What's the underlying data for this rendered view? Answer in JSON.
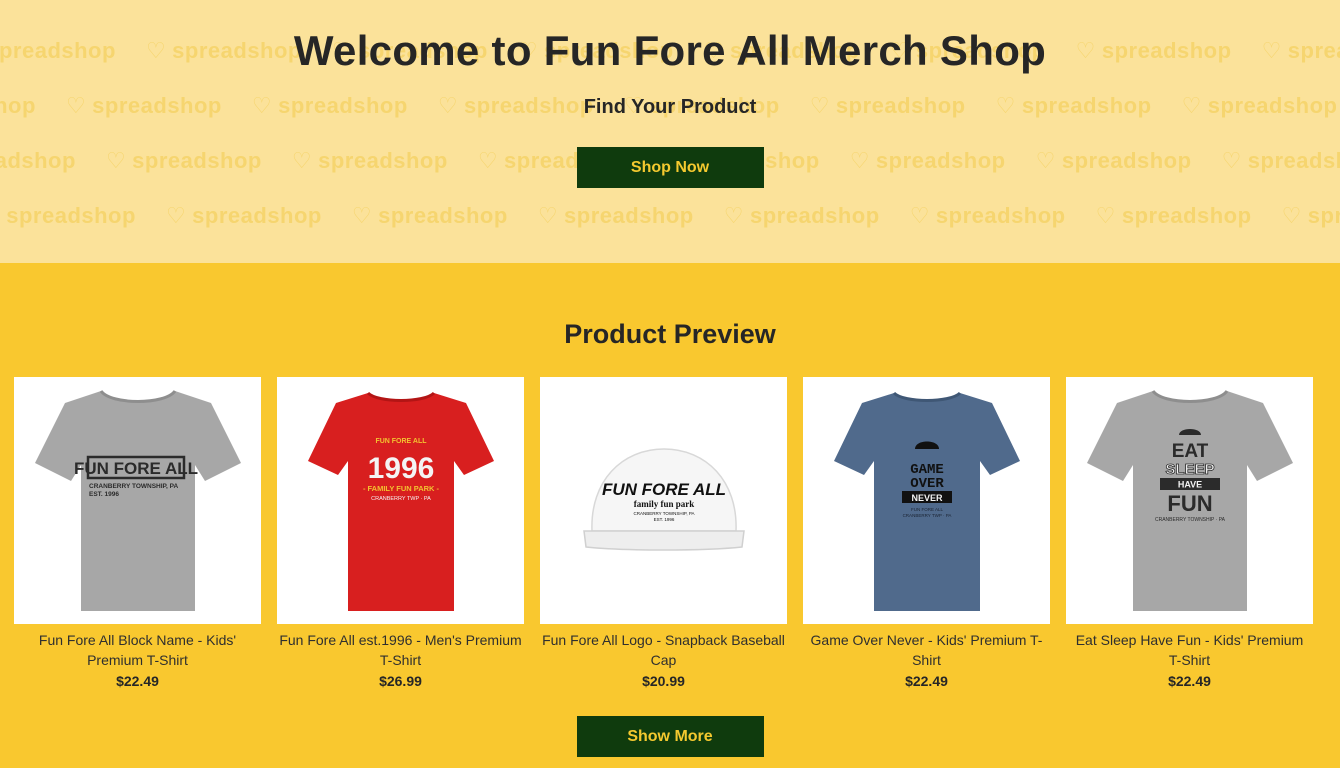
{
  "hero": {
    "watermark_text": "spreadshop",
    "title": "Welcome to Fun Fore All Merch Shop",
    "subtitle": "Find Your Product",
    "cta_label": "Shop Now"
  },
  "preview": {
    "title": "Product Preview",
    "show_more_label": "Show More"
  },
  "products": [
    {
      "name": "Fun Fore All Block Name - Kids' Premium T-Shirt",
      "price": "$22.49",
      "image": "grey-tshirt",
      "print": [
        "FUN FORE ALL",
        "CRANBERRY TOWNSHIP, PA",
        "EST. 1996"
      ]
    },
    {
      "name": "Fun Fore All est.1996 - Men's Premium T-Shirt",
      "price": "$26.99",
      "image": "red-tshirt",
      "print": [
        "FUN FORE ALL",
        "1996",
        "- FAMILY FUN PARK -",
        "CRANBERRY TWP · PA"
      ]
    },
    {
      "name": "Fun Fore All Logo - Snapback Baseball Cap",
      "price": "$20.99",
      "image": "white-cap",
      "print": [
        "FUN FORE ALL",
        "family fun park",
        "CRANBERRY TOWNSHIP, PA",
        "EST. 1996"
      ]
    },
    {
      "name": "Game Over Never - Kids' Premium T-Shirt",
      "price": "$22.49",
      "image": "blue-tshirt",
      "print": [
        "GAME",
        "OVER",
        "NEVER",
        "FUN FORE ALL",
        "CRANBERRY TWP · PA"
      ]
    },
    {
      "name": "Eat Sleep Have Fun - Kids' Premium T-Shirt",
      "price": "$22.49",
      "image": "grey-tshirt",
      "print": [
        "EAT",
        "SLEEP",
        "HAVE",
        "FUN",
        "CRANBERRY TOWNSHIP · PA"
      ]
    }
  ],
  "colors": {
    "hero_bg": "#fbe29a",
    "page_bg": "#f9c82f",
    "button_bg": "#0f3b0d",
    "button_text": "#f4c92f"
  }
}
